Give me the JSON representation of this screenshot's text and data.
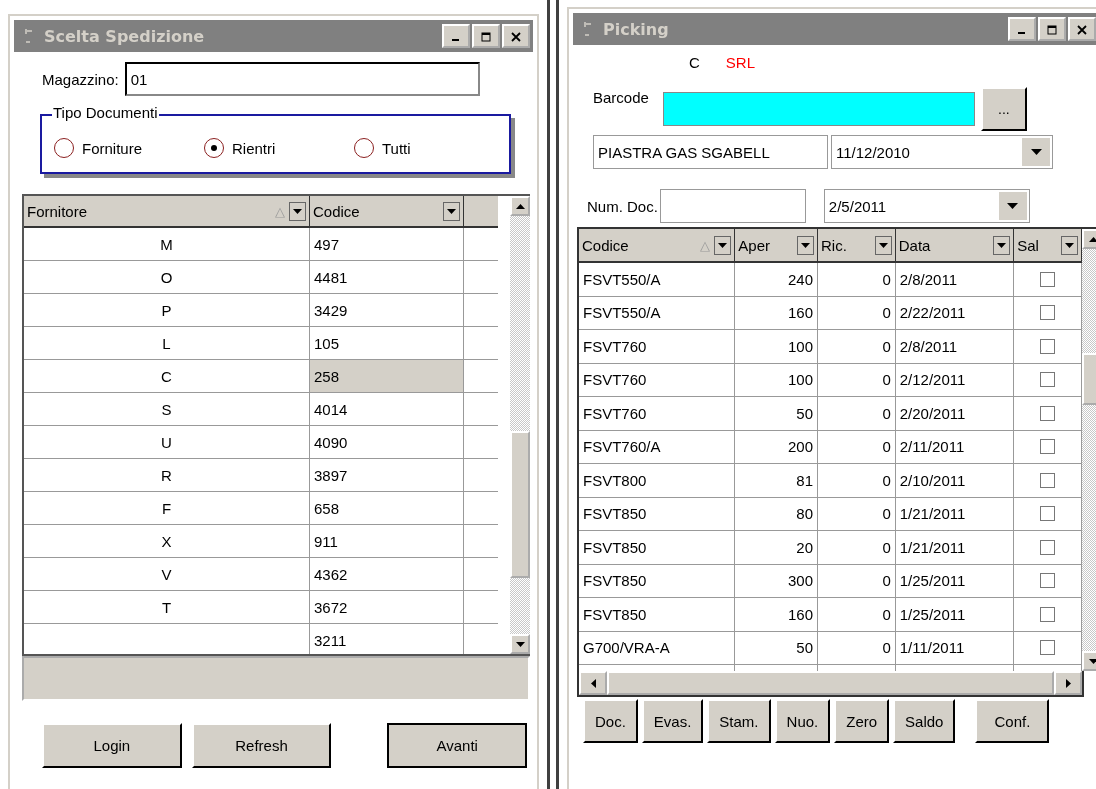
{
  "left_window": {
    "title": "Scelta Spedizione",
    "magazzino_label": "Magazzino:",
    "magazzino_value": "01",
    "group_title": "Tipo Documenti",
    "radios": [
      {
        "label": "Forniture",
        "selected": false
      },
      {
        "label": "Rientri",
        "selected": true
      },
      {
        "label": "Tutti",
        "selected": false
      }
    ],
    "table": {
      "columns": [
        {
          "label": "Fornitore",
          "sort": "△"
        },
        {
          "label": "Codice"
        }
      ],
      "rows": [
        {
          "fornitore": "M",
          "codice": "497",
          "selected": false
        },
        {
          "fornitore": "O",
          "codice": "4481",
          "selected": false
        },
        {
          "fornitore": "P",
          "codice": "3429",
          "selected": false
        },
        {
          "fornitore": "L",
          "codice": "105",
          "selected": false
        },
        {
          "fornitore": "C",
          "codice": "258",
          "selected": true
        },
        {
          "fornitore": "S",
          "codice": "4014",
          "selected": false
        },
        {
          "fornitore": "U",
          "codice": "4090",
          "selected": false
        },
        {
          "fornitore": "R",
          "codice": "3897",
          "selected": false
        },
        {
          "fornitore": "F",
          "codice": "658",
          "selected": false
        },
        {
          "fornitore": "X",
          "codice": "911",
          "selected": false
        },
        {
          "fornitore": "V",
          "codice": "4362",
          "selected": false
        },
        {
          "fornitore": "T",
          "codice": "3672",
          "selected": false
        },
        {
          "fornitore": "",
          "codice": "3211",
          "selected": false
        }
      ]
    },
    "buttons": [
      "Login",
      "Refresh",
      "Avanti"
    ]
  },
  "right_window": {
    "title": "Picking",
    "customer_code": "C",
    "customer_name": "SRL",
    "barcode_label": "Barcode",
    "browse_button": "...",
    "description": "PIASTRA GAS SGABELL",
    "date_1": "11/12/2010",
    "num_doc_label": "Num. Doc.",
    "date_2": "2/5/2011",
    "table": {
      "columns": [
        {
          "label": "Codice",
          "sort": "△"
        },
        {
          "label": "Aper"
        },
        {
          "label": "Ric."
        },
        {
          "label": "Data"
        },
        {
          "label": "Sal"
        }
      ],
      "rows": [
        {
          "codice": "FSVT550/A",
          "aper": "240",
          "ric": "0",
          "data": "2/8/2011",
          "checked": false
        },
        {
          "codice": "FSVT550/A",
          "aper": "160",
          "ric": "0",
          "data": "2/22/2011",
          "checked": false
        },
        {
          "codice": "FSVT760",
          "aper": "100",
          "ric": "0",
          "data": "2/8/2011",
          "checked": false
        },
        {
          "codice": "FSVT760",
          "aper": "100",
          "ric": "0",
          "data": "2/12/2011",
          "checked": false
        },
        {
          "codice": "FSVT760",
          "aper": "50",
          "ric": "0",
          "data": "2/20/2011",
          "checked": false
        },
        {
          "codice": "FSVT760/A",
          "aper": "200",
          "ric": "0",
          "data": "2/11/2011",
          "checked": false
        },
        {
          "codice": "FSVT800",
          "aper": "81",
          "ric": "0",
          "data": "2/10/2011",
          "checked": false
        },
        {
          "codice": "FSVT850",
          "aper": "80",
          "ric": "0",
          "data": "1/21/2011",
          "checked": false
        },
        {
          "codice": "FSVT850",
          "aper": "20",
          "ric": "0",
          "data": "1/21/2011",
          "checked": false
        },
        {
          "codice": "FSVT850",
          "aper": "300",
          "ric": "0",
          "data": "1/25/2011",
          "checked": false
        },
        {
          "codice": "FSVT850",
          "aper": "160",
          "ric": "0",
          "data": "1/25/2011",
          "checked": false
        },
        {
          "codice": "G700/VRA-A",
          "aper": "50",
          "ric": "0",
          "data": "1/11/2011",
          "checked": false
        }
      ]
    },
    "buttons": [
      "Doc.",
      "Evas.",
      "Stam.",
      "Nuo.",
      "Zero",
      "Saldo"
    ],
    "confirm_button": "Conf."
  }
}
